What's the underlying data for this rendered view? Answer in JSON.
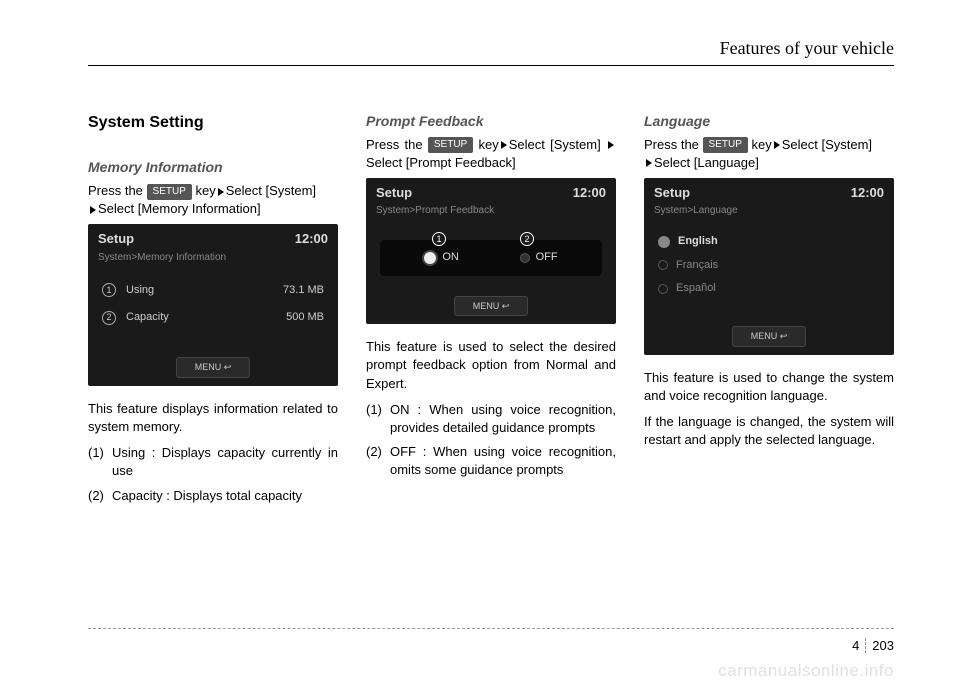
{
  "header": {
    "title": "Features of your vehicle"
  },
  "col1": {
    "h2": "System Setting",
    "h3": "Memory Information",
    "instr_pre": "Press the ",
    "key": "SETUP",
    "instr_mid": " key",
    "instr_sel1": "Select [System]",
    "instr_sel2": "Select [Memory Information]",
    "screen": {
      "title": "Setup",
      "time": "12:00",
      "crumb": "System>Memory Information",
      "r1_n": "1",
      "r1_label": "Using",
      "r1_val": "73.1 MB",
      "r2_n": "2",
      "r2_label": "Capacity",
      "r2_val": "500 MB",
      "menu": "MENU ↩"
    },
    "para": "This feature displays information related to system memory.",
    "li1_n": "(1)",
    "li1_t": "Using : Displays capacity currently in use",
    "li2_n": "(2)",
    "li2_t": "Capacity : Displays total capacity"
  },
  "col2": {
    "h3": "Prompt Feedback",
    "instr_pre": "Press the ",
    "key": "SETUP",
    "instr_mid": " key",
    "instr_sel1": "Select [System] ",
    "instr_sel2": "Select [Prompt Feedback]",
    "screen": {
      "title": "Setup",
      "time": "12:00",
      "crumb": "System>Prompt Feedback",
      "n1": "1",
      "opt1": "ON",
      "n2": "2",
      "opt2": "OFF",
      "menu": "MENU ↩"
    },
    "para": "This feature is used to select the desired prompt feedback option from Normal and Expert.",
    "li1_n": "(1)",
    "li1_t": "ON : When using voice recognition, provides detailed guidance prompts",
    "li2_n": "(2)",
    "li2_t": "OFF : When using voice recognition, omits some guidance prompts"
  },
  "col3": {
    "h3": "Language",
    "instr_pre": "Press the ",
    "key": "SETUP",
    "instr_mid": " key",
    "instr_sel1": "Select [System]",
    "instr_sel2": "Select [Language]",
    "screen": {
      "title": "Setup",
      "time": "12:00",
      "crumb": "System>Language",
      "opt1": "English",
      "opt2": "Français",
      "opt3": "Español",
      "menu": "MENU ↩"
    },
    "para1": "This feature is used to change the system and voice recognition language.",
    "para2": "If the language is changed, the system will restart and apply the selected language."
  },
  "footer": {
    "section": "4",
    "page": "203"
  },
  "watermark": "carmanualsonline.info"
}
